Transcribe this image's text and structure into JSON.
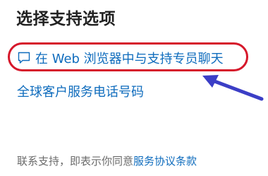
{
  "panel": {
    "title": "选择支持选项",
    "chat_link_label": "在 Web 浏览器中与支持专员聊天",
    "phone_link_label": "全球客户服务电话号码",
    "footer_prefix": "联系支持，即表示你同意",
    "footer_terms_link": "服务协议条款",
    "icons": {
      "chat": "chat-bubble-icon"
    }
  },
  "colors": {
    "link": "#0f6cbd",
    "annotation_oval": "#d6182b",
    "annotation_arrow": "#3b3ec6"
  }
}
